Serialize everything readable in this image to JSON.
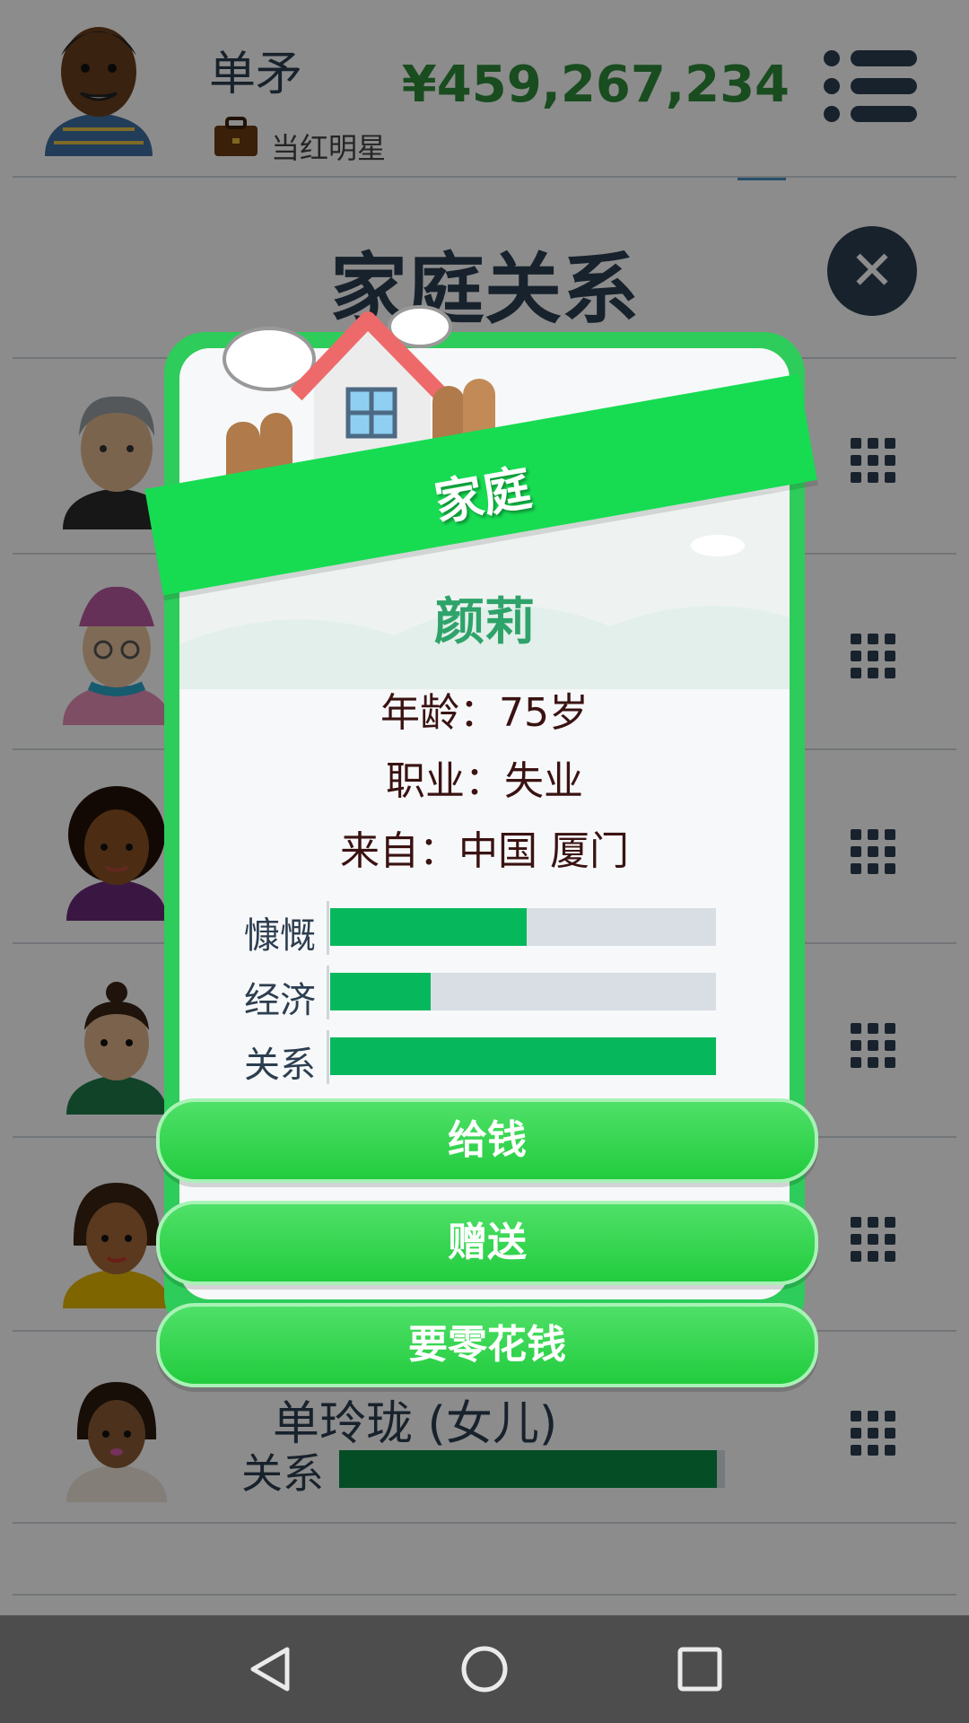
{
  "header": {
    "player_name": "单矛",
    "job_label": "当红明星",
    "money": "¥459,267,234"
  },
  "page": {
    "title": "家庭关系"
  },
  "family_list": [
    {
      "name": "",
      "relationship_level": 0
    },
    {
      "name": "",
      "relationship_level": 0
    },
    {
      "name": "",
      "relationship_level": 0
    },
    {
      "name": "",
      "relationship_level": 0
    },
    {
      "name": "",
      "relationship_level": 0
    },
    {
      "name": "单玲珑 (女儿)",
      "relationship_label": "关系",
      "relationship_level": 0.98
    }
  ],
  "dialog": {
    "banner": "家庭",
    "member_name": "颜莉",
    "age_line": "年龄：75岁",
    "job_line": "职业：失业",
    "origin_line": "来自：中国 厦门",
    "stats": [
      {
        "label": "慷慨",
        "value": 0.51
      },
      {
        "label": "经济",
        "value": 0.26
      },
      {
        "label": "关系",
        "value": 1.0
      }
    ],
    "buttons": {
      "give_money": "给钱",
      "gift": "赠送",
      "ask_allowance": "要零花钱"
    }
  },
  "colors": {
    "accent_green": "#2ecc5a",
    "stat_fill": "#06b85b",
    "money_green": "#2e8b3a",
    "dark_navy": "#2c3e50"
  },
  "icons": {
    "menu": "hamburger-menu-icon",
    "close": "close-icon",
    "row_action": "grid-icon",
    "job": "briefcase-icon",
    "nav_back": "triangle-back-icon",
    "nav_home": "circle-home-icon",
    "nav_recent": "square-recent-icon"
  }
}
